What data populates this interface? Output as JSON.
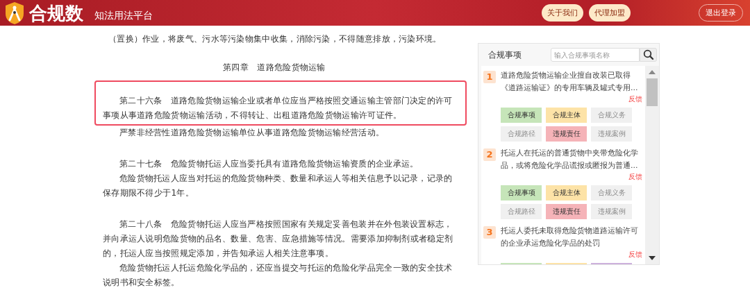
{
  "header": {
    "brand": "合规数",
    "subtitle": "知法用法平台",
    "buttons": [
      "关于我们",
      "代理加盟"
    ],
    "logout": "退出登录"
  },
  "article": [
    {
      "kind": "para",
      "text": "（置换）作业，将废气、污水等污染物集中收集，消除污染，不得随意排放，污染环境。",
      "noindent": true
    },
    {
      "kind": "heading",
      "text": "第四章　道路危险货物运输"
    },
    {
      "kind": "para",
      "text": "第二十六条　道路危险货物运输企业或者单位应当严格按照交通运输主管部门决定的许可事项从事道路危险货物运输活动，不得转让、出租道路危险货物运输许可证件。",
      "highlighted": true
    },
    {
      "kind": "para",
      "text": "严禁非经营性道路危险货物运输单位从事道路危险货物运输经营活动。"
    },
    {
      "kind": "para",
      "text": "第二十七条　危险货物托运人应当委托具有道路危险货物运输资质的企业承运。",
      "gap": true
    },
    {
      "kind": "para",
      "text": "危险货物托运人应当对托运的危险货物种类、数量和承运人等相关信息予以记录，记录的保存期限不得少于1年。"
    },
    {
      "kind": "para",
      "text": "第二十八条　危险货物托运人应当严格按照国家有关规定妥善包装并在外包装设置标志，并向承运人说明危险货物的品名、数量、危害、应急措施等情况。需要添加抑制剂或者稳定剂的，托运人应当按照规定添加，并告知承运人相关注意事项。",
      "gap": true
    },
    {
      "kind": "para",
      "text": "危险货物托运人托运危险化学品的，还应当提交与托运的危险化学品完全一致的安全技术说明书和安全标签。"
    }
  ],
  "panel": {
    "title": "合规事项",
    "search": {
      "placeholder": "输入合规事项名称"
    },
    "items": [
      {
        "number": "1",
        "title": "道路危险货物运输企业擅自改装已取得《道路运输证》的专用车辆及罐式专用...",
        "feedback": "反馈",
        "tags": [
          {
            "label": "合规事项",
            "active": true,
            "color": "#c6e5b9"
          },
          {
            "label": "合规主体",
            "active": true,
            "color": "#fde3a7"
          },
          {
            "label": "合规义务",
            "active": false
          },
          {
            "label": "合规路径",
            "active": false
          },
          {
            "label": "违规责任",
            "active": true,
            "color": "#f5b3b8"
          },
          {
            "label": "违规案例",
            "active": false
          }
        ]
      },
      {
        "number": "2",
        "title": "托运人在托运的普通货物中夹带危险化学品，或将危险化学品谎报或匿报为普通...",
        "feedback": "反馈",
        "tags": [
          {
            "label": "合规事项",
            "active": true,
            "color": "#c6e5b9"
          },
          {
            "label": "合规主体",
            "active": true,
            "color": "#fde3a7"
          },
          {
            "label": "合规义务",
            "active": false
          },
          {
            "label": "合规路径",
            "active": false
          },
          {
            "label": "违规责任",
            "active": true,
            "color": "#f5b3b8"
          },
          {
            "label": "违规案例",
            "active": false
          }
        ]
      },
      {
        "number": "3",
        "title": "托运人委托未取得危险货物道路运输许可的企业承运危险化学品的处罚",
        "feedback": "反馈",
        "tags": [
          {
            "active": true,
            "color": "#c6e5b9"
          },
          {
            "active": true,
            "color": "#fde3a7"
          },
          {
            "active": true,
            "color": "#cdb1dc"
          }
        ]
      }
    ]
  }
}
